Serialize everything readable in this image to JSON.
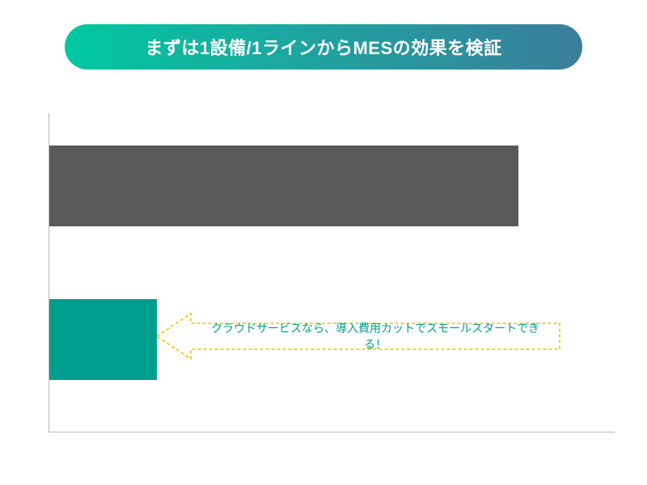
{
  "title": "まずは1設備/1ラインからMESの効果を検証",
  "callout_text": "クラウドサービスなら、導入費用カットでスモールスタートできる！",
  "chart_data": {
    "type": "bar",
    "orientation": "horizontal",
    "categories": [
      "",
      ""
    ],
    "series": [
      {
        "name": "large",
        "value": 83,
        "color": "#595959"
      },
      {
        "name": "small",
        "value": 19,
        "color": "#009e8e"
      }
    ],
    "xlim": [
      0,
      100
    ],
    "title": "まずは1設備/1ラインからMESの効果を検証",
    "xlabel": "",
    "ylabel": "",
    "annotations": [
      {
        "text": "クラウドサービスなら、導入費用カットでスモールスタートできる！",
        "attached_to": "small"
      }
    ]
  },
  "colors": {
    "title_gradient_start": "#00c9a0",
    "title_gradient_end": "#3b7d9b",
    "bar_large": "#595959",
    "bar_small": "#009e8e",
    "callout_border": "#f2c200",
    "callout_text": "#009e8e",
    "axis": "#b8b8b8"
  }
}
